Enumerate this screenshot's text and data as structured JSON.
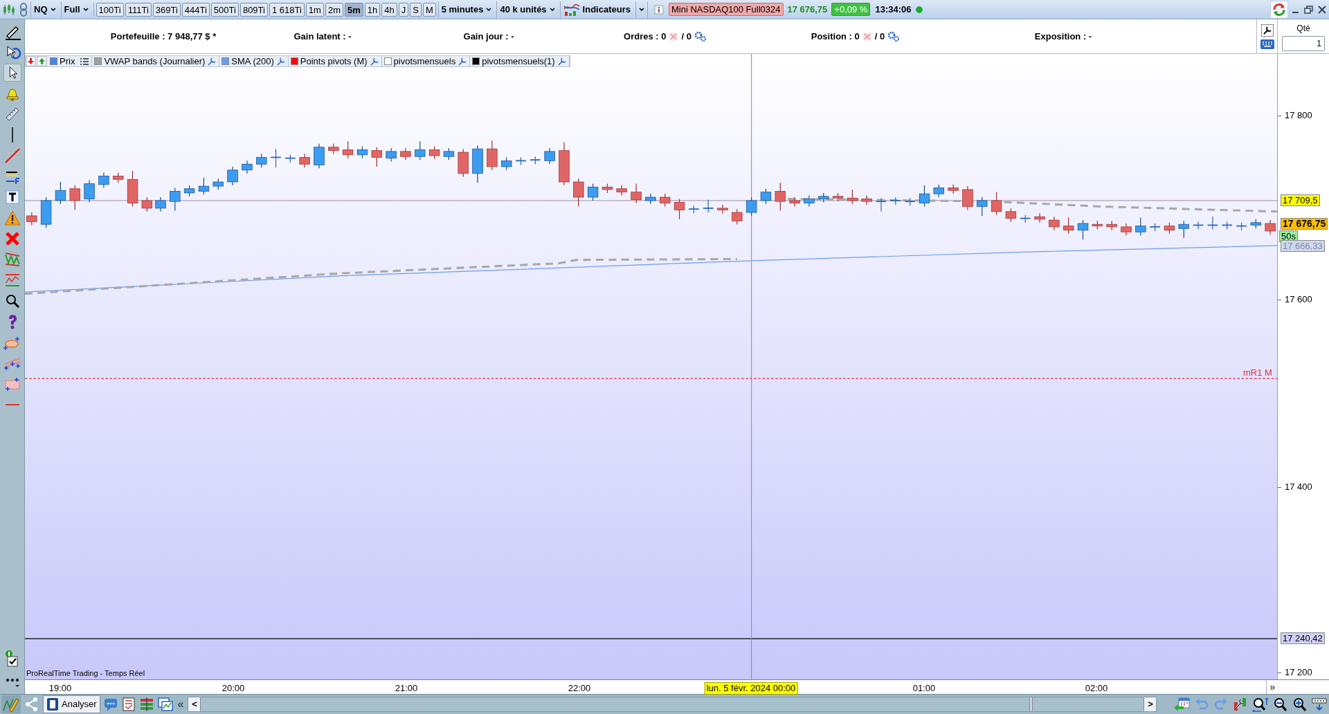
{
  "toolbar": {
    "symbol": "NQ",
    "mode": "Full",
    "period": "5 minutes",
    "units": "40 k unités",
    "indicators": "Indicateurs",
    "instrument": "Mini NASDAQ100 Full0324",
    "last_price": "17 676,75",
    "change": "+0,09 %",
    "time": "13:34:06",
    "connected": true,
    "intervals": [
      {
        "label": "100Ti",
        "selected": false
      },
      {
        "label": "111Ti",
        "selected": false
      },
      {
        "label": "369Ti",
        "selected": false
      },
      {
        "label": "444Ti",
        "selected": false
      },
      {
        "label": "500Ti",
        "selected": false
      },
      {
        "label": "809Ti",
        "selected": false
      },
      {
        "label": "1 618Ti",
        "selected": false
      },
      {
        "label": "1m",
        "selected": false
      },
      {
        "label": "2m",
        "selected": false
      },
      {
        "label": "5m",
        "selected": true
      },
      {
        "label": "1h",
        "selected": false
      },
      {
        "label": "4h",
        "selected": false
      },
      {
        "label": "J",
        "selected": false
      },
      {
        "label": "S",
        "selected": false
      },
      {
        "label": "M",
        "selected": false
      }
    ]
  },
  "account": {
    "portfolio": "Portefeuille : 7 948,77 $ *",
    "unrealized": "Gain latent : -",
    "daily_gain": "Gain jour : -",
    "orders": "Ordres : 0",
    "orders_total": "/ 0",
    "position": "Position : 0",
    "position_total": "/ 0",
    "exposure": "Exposition : -",
    "qty_label": "Qté",
    "qty_value": "1"
  },
  "legend": [
    {
      "label": "Prix",
      "color": "#4a86e8"
    },
    {
      "label": "VWAP bands (Journalier)",
      "color": "#a0a0a0"
    },
    {
      "label": "SMA (200)",
      "color": "#6d9eeb"
    },
    {
      "label": "Points pivots (M)",
      "color": "#ff0000"
    },
    {
      "label": "pivotsmensuels",
      "color": "#ffffff"
    },
    {
      "label": "pivotsmensuels(1)",
      "color": "#000000"
    }
  ],
  "chart": {
    "footer": "ProRealTime Trading - Temps Réel",
    "pivot_label": "mR1 M",
    "crosshair_date": "lun. 5 févr. 2024 00:00",
    "scroll_more": "»",
    "price_ticks": [
      "17 800",
      "17 600",
      "17 400",
      "17 200"
    ],
    "price_markers": [
      {
        "label": "17 709,5",
        "color": "#ffff00"
      },
      {
        "label": "17 676,75",
        "color": "#ffc000"
      },
      {
        "label": "50s",
        "color": "#98f098"
      },
      {
        "label": "17 666,33",
        "color": "#d0d8f0"
      },
      {
        "label": "17 240,42",
        "color": "#d0d0f8"
      }
    ],
    "time_ticks": [
      "19:00",
      "20:00",
      "21:00",
      "22:00",
      "01:00",
      "02:00"
    ]
  },
  "bottom_bar": {
    "analyse": "Analyser",
    "collapse": "«",
    "scroll_left": "<",
    "scroll_right": ">"
  }
}
